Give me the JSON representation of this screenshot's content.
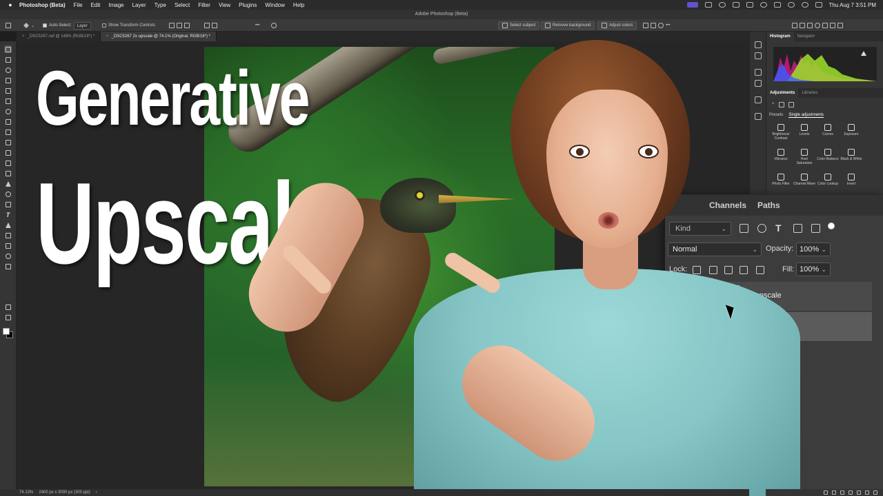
{
  "menubar": {
    "app_name": "Photoshop (Beta)",
    "items": [
      "File",
      "Edit",
      "Image",
      "Layer",
      "Type",
      "Select",
      "Filter",
      "View",
      "Plugins",
      "Window",
      "Help"
    ],
    "clock": "Thu Aug 7  3:51 PM"
  },
  "window": {
    "title": "Adobe Photoshop (Beta)"
  },
  "options_bar": {
    "auto_select_label": "Auto-Select:",
    "auto_select_value": "Layer",
    "transform_controls_label": "Show Transform Controls",
    "select_subject": "Select subject",
    "remove_background": "Remove background",
    "adjust_colors": "Adjust colors"
  },
  "doc_tabs": [
    {
      "label": "_DSC5267.nef @ 148% (RGB/16*) *"
    },
    {
      "label": "_DSC5267 2x upscale @ 74.1% (Original, RGB/16*) *"
    }
  ],
  "overlay": {
    "line1": "Generative",
    "line2": "Upscale"
  },
  "panels": {
    "histogram_tab": "Histogram",
    "navigator_tab": "Navigator",
    "adjustments_tab": "Adjustments",
    "libraries_tab": "Libraries",
    "presets_tab": "Presets",
    "single_adjustments_tab": "Single adjustments",
    "adjustments": [
      "Brightness/ Contrast",
      "Levels",
      "Curves",
      "Exposure",
      "Vibrance",
      "Hue/ Saturation",
      "Color Balance",
      "Black & White",
      "Photo Filter",
      "Channel Mixer",
      "Color Lookup",
      "Invert"
    ]
  },
  "layers": {
    "tab_channels": "Channels",
    "tab_paths": "Paths",
    "kind_label": "Kind",
    "blend_mode": "Normal",
    "opacity_label": "Opacity:",
    "opacity_value": "100%",
    "lock_label": "Lock:",
    "fill_label": "Fill:",
    "fill_value": "100%",
    "layer_name": "2x upscale"
  },
  "statusbar": {
    "zoom": "74.13%",
    "doc_info": "2400 px x 3000 px (300 ppi)"
  }
}
